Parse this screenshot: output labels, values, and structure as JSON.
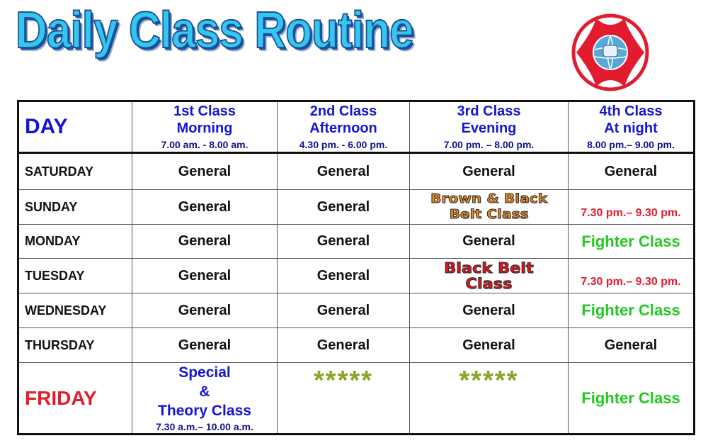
{
  "title": "Daily Class Routine",
  "header": {
    "day": "DAY",
    "classes": [
      {
        "line1": "1st Class",
        "line2": "Morning",
        "time": "7.00 am.  -  8.00 am."
      },
      {
        "line1": "2nd Class",
        "line2": "Afternoon",
        "time": "4.30 pm.  -  6.00 pm."
      },
      {
        "line1": "3rd Class",
        "line2": "Evening",
        "time": "7.00 pm.  –  8.00 pm."
      },
      {
        "line1": "4th Class",
        "line2": "At night",
        "time": "8.00 pm.– 9.00 pm."
      }
    ]
  },
  "rows": [
    {
      "day": "SATURDAY",
      "c1": "General",
      "c2": "General",
      "c3": "General",
      "c4": "General"
    },
    {
      "day": "SUNDAY",
      "c1": "General",
      "c2": "General",
      "c3_line1": "Brown & Black",
      "c3_line2": "Belt Class",
      "c4": "7.30 pm.– 9.30 pm."
    },
    {
      "day": "MONDAY",
      "c1": "General",
      "c2": "General",
      "c3": "General",
      "c4": "Fighter Class"
    },
    {
      "day": "TUESDAY",
      "c1": "General",
      "c2": "General",
      "c3_line1": "Black Belt",
      "c3_line2": "Class",
      "c4": "7.30 pm.– 9.30 pm."
    },
    {
      "day": "WEDNESDAY",
      "c1": "General",
      "c2": "General",
      "c3": "General",
      "c4": "Fighter Class"
    },
    {
      "day": "THURSDAY",
      "c1": "General",
      "c2": "General",
      "c3": "General",
      "c4": "General"
    },
    {
      "day": "FRIDAY",
      "c1_line1": "Special",
      "c1_line2": "&",
      "c1_line3": "Theory Class",
      "c1_time": "7.30 a.m.– 10.00 a.m.",
      "c2": "*****",
      "c3": "*****",
      "c4": "Fighter Class"
    }
  ],
  "colors": {
    "title_fill": "#33c7ee",
    "title_outline": "#1d4f9a",
    "header_text": "#1515d4",
    "accent_red": "#e21b2e",
    "fighter_green": "#22c822",
    "stars_olive": "#8aa628",
    "badge_orange": "#f08a1c"
  },
  "logo": {
    "icon": "kyokushin-emblem-icon",
    "color": "#e21b2e"
  }
}
